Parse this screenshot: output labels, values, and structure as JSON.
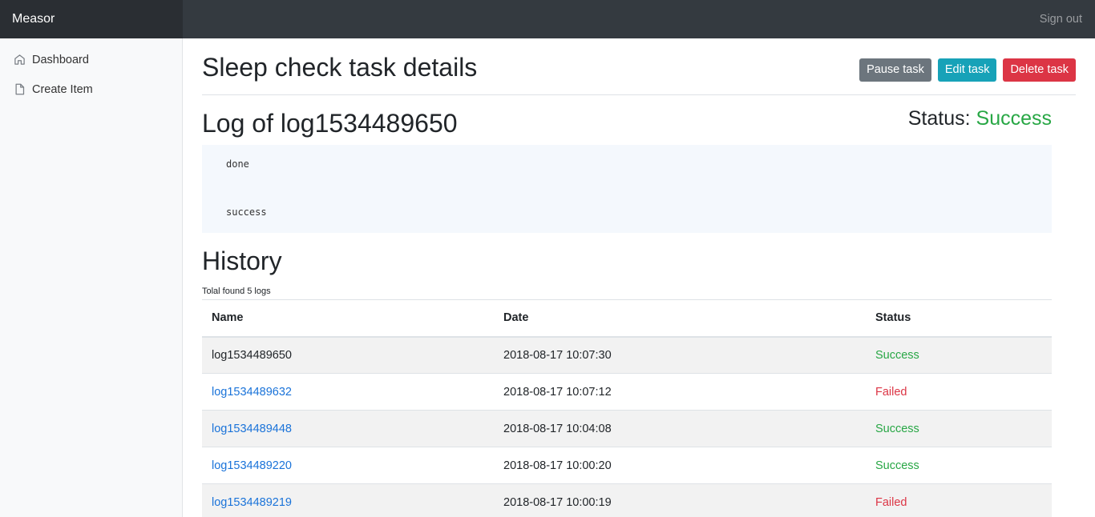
{
  "navbar": {
    "brand": "Measor",
    "signout_label": "Sign out"
  },
  "sidebar": {
    "items": [
      {
        "label": "Dashboard",
        "icon": "home-icon"
      },
      {
        "label": "Create Item",
        "icon": "file-icon"
      }
    ]
  },
  "header": {
    "title": "Sleep check task details",
    "pause_label": "Pause task",
    "edit_label": "Edit task",
    "delete_label": "Delete task"
  },
  "log": {
    "title": "Log of log1534489650",
    "status_label": "Status:",
    "status_value": "Success",
    "lines": [
      "done",
      "success"
    ]
  },
  "history": {
    "title": "History",
    "total": "Tolal found 5 logs",
    "columns": [
      "Name",
      "Date",
      "Status"
    ],
    "rows": [
      {
        "name": "log1534489650",
        "date": "2018-08-17 10:07:30",
        "status": "Success"
      },
      {
        "name": "log1534489632",
        "date": "2018-08-17 10:07:12",
        "status": "Failed"
      },
      {
        "name": "log1534489448",
        "date": "2018-08-17 10:04:08",
        "status": "Success"
      },
      {
        "name": "log1534489220",
        "date": "2018-08-17 10:00:20",
        "status": "Success"
      },
      {
        "name": "log1534489219",
        "date": "2018-08-17 10:00:19",
        "status": "Failed"
      }
    ]
  },
  "colors": {
    "navbar": "#343a40",
    "success": "#28a745",
    "failed": "#dc3545",
    "link": "#1a73d9",
    "pause": "#6c757d",
    "edit": "#17a2b8",
    "delete": "#dc3545"
  }
}
